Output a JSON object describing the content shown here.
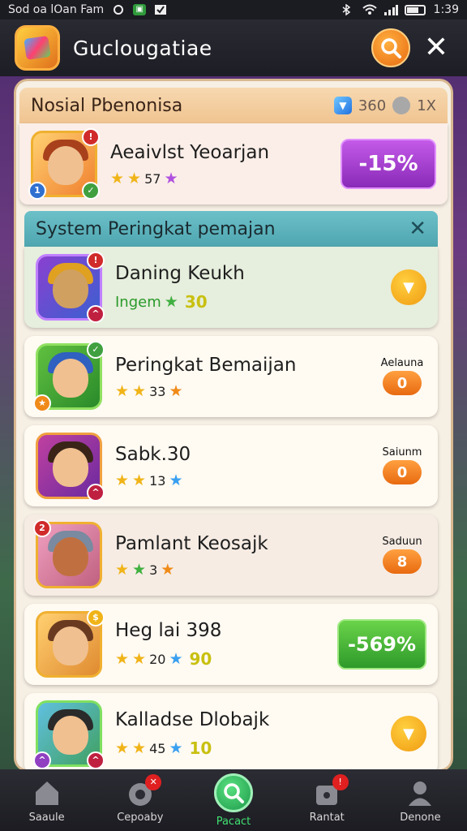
{
  "status_bar": {
    "left_text": "Sod oa lOan Fam",
    "time": "1:39"
  },
  "header": {
    "title": "Guclougatiae"
  },
  "section1": {
    "title": "Nosial Pbenonisa",
    "gem_count": "360",
    "multiplier": "1X",
    "card": {
      "name": "Aeaivlst Yeoarjan",
      "stars_text": "57",
      "action_label": "-15%"
    }
  },
  "section2": {
    "title": "System Peringkat pemajan",
    "close": "✕"
  },
  "cards": [
    {
      "name": "Daning Keukh",
      "sub_text": "Ingem",
      "level": "30",
      "stars_text": "",
      "right_type": "coin"
    },
    {
      "name": "Peringkat Bemaijan",
      "stars_text": "33",
      "stat_label": "Aelauna",
      "stat_value": "0"
    },
    {
      "name": "Sabk.30",
      "stars_text": "13",
      "stat_label": "Saiunm",
      "stat_value": "0"
    },
    {
      "name": "Pamlant Keosajk",
      "stars_text": "3",
      "stat_label": "Saduun",
      "stat_value": "8"
    },
    {
      "name": "Heg lai 398",
      "stars_text": "20",
      "level": "90",
      "action_label": "-569%"
    },
    {
      "name": "Kalladse Dlobajk",
      "stars_text": "45",
      "level": "10"
    }
  ],
  "bottom_nav": [
    {
      "label": "Saaule",
      "icon": "home-icon"
    },
    {
      "label": "Cepoaby",
      "icon": "camera-icon",
      "badge": "✕"
    },
    {
      "label": "Pacact",
      "icon": "search-icon",
      "active": true
    },
    {
      "label": "Rantat",
      "icon": "shop-icon",
      "badge": "!"
    },
    {
      "label": "Denone",
      "icon": "profile-icon"
    }
  ]
}
